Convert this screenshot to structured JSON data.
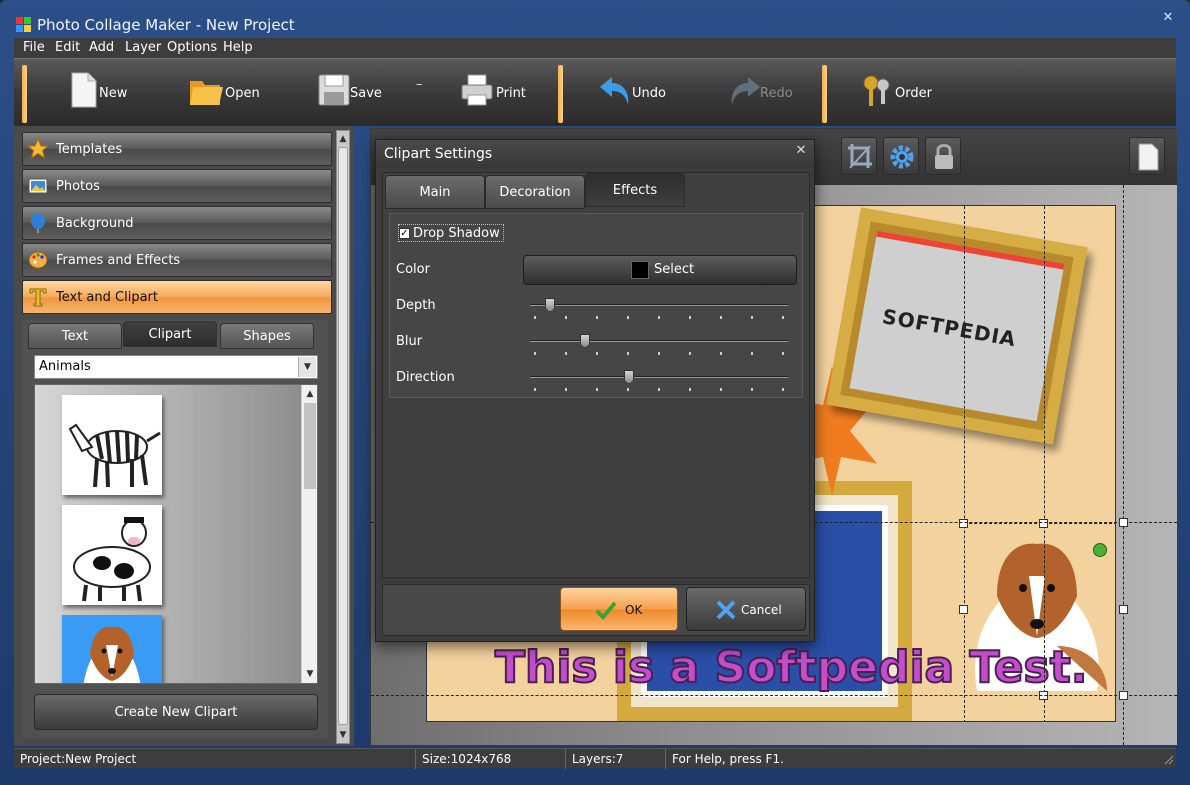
{
  "window": {
    "title": "Photo Collage Maker - New Project"
  },
  "menu": [
    "File",
    "Edit",
    "Add",
    "Layer",
    "Options",
    "Help"
  ],
  "toolbar": {
    "new": "New",
    "open": "Open",
    "save": "Save",
    "print": "Print",
    "undo": "Undo",
    "redo": "Redo",
    "order": "Order"
  },
  "sidebar": {
    "categories": [
      {
        "label": "Templates",
        "icon": "star-icon"
      },
      {
        "label": "Photos",
        "icon": "photo-icon"
      },
      {
        "label": "Background",
        "icon": "balloon-icon"
      },
      {
        "label": "Frames and Effects",
        "icon": "palette-icon"
      },
      {
        "label": "Text and Clipart",
        "icon": "text-t-icon",
        "active": true
      }
    ],
    "subtabs": [
      {
        "label": "Text"
      },
      {
        "label": "Clipart",
        "active": true
      },
      {
        "label": "Shapes"
      }
    ],
    "clipart_category": "Animals",
    "cliparts": [
      "zebra",
      "cow",
      "collie"
    ],
    "create_button": "Create New Clipart"
  },
  "canvas": {
    "logo_text": "SOFTPEDIA",
    "caption": "This is a Softpedia Test."
  },
  "dialog": {
    "title": "Clipart Settings",
    "tabs": [
      {
        "label": "Main"
      },
      {
        "label": "Decoration"
      },
      {
        "label": "Effects",
        "active": true
      }
    ],
    "drop_shadow": {
      "label": "Drop Shadow",
      "checked": true
    },
    "color": {
      "label": "Color",
      "button": "Select",
      "value": "#000000"
    },
    "sliders": [
      {
        "label": "Depth",
        "value": 0.06
      },
      {
        "label": "Blur",
        "value": 0.2
      },
      {
        "label": "Direction",
        "value": 0.38
      }
    ],
    "ok": "OK",
    "cancel": "Cancel"
  },
  "status": {
    "project": "Project:New Project",
    "size": "Size:1024x768",
    "layers": "Layers:7",
    "help": "For Help, press F1."
  },
  "colors": {
    "accent": "#f6a04d",
    "panel": "#4a4a4a",
    "paper": "#f3d29e"
  }
}
